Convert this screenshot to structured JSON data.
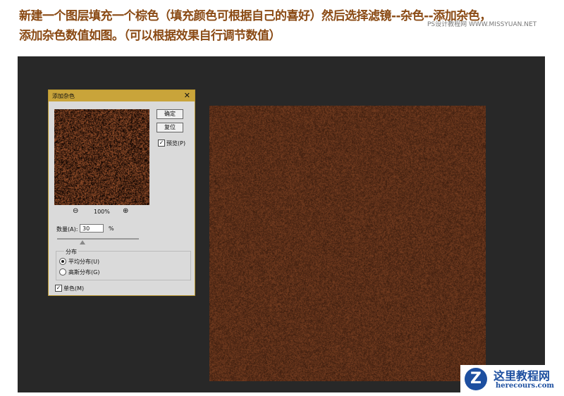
{
  "caption": {
    "line1": "新建一个图层填充一个棕色（填充颜色可根据自己的喜好）然后选择滤镜--杂色--添加杂色，",
    "line2": "添加杂色数值如图。（可以根据效果自行调节数值）"
  },
  "watermark": "PS设计教程网  WWW.MISSYUAN.NET",
  "dialog": {
    "title": "添加杂色",
    "close": "✕",
    "ok": "确定",
    "reset": "复位",
    "preview_label": "预览(P)",
    "preview_checked": true,
    "zoom": "100%",
    "amount_label": "数量(A):",
    "amount": "30",
    "amount_unit": "%",
    "amount_value_percent": 30,
    "distribution_label": "分布",
    "uniform": "平均分布(U)",
    "gaussian": "高斯分布(G)",
    "selected": "uniform",
    "mono_label": "单色(M)",
    "mono_checked": true,
    "check": "✓"
  },
  "colors": {
    "brown": "#5a2e18",
    "titlebar": "#c9a43a",
    "caption": "#8a4a14"
  },
  "logo": {
    "name": "这里教程网",
    "url": "herecours.com",
    "letter": "Z"
  }
}
